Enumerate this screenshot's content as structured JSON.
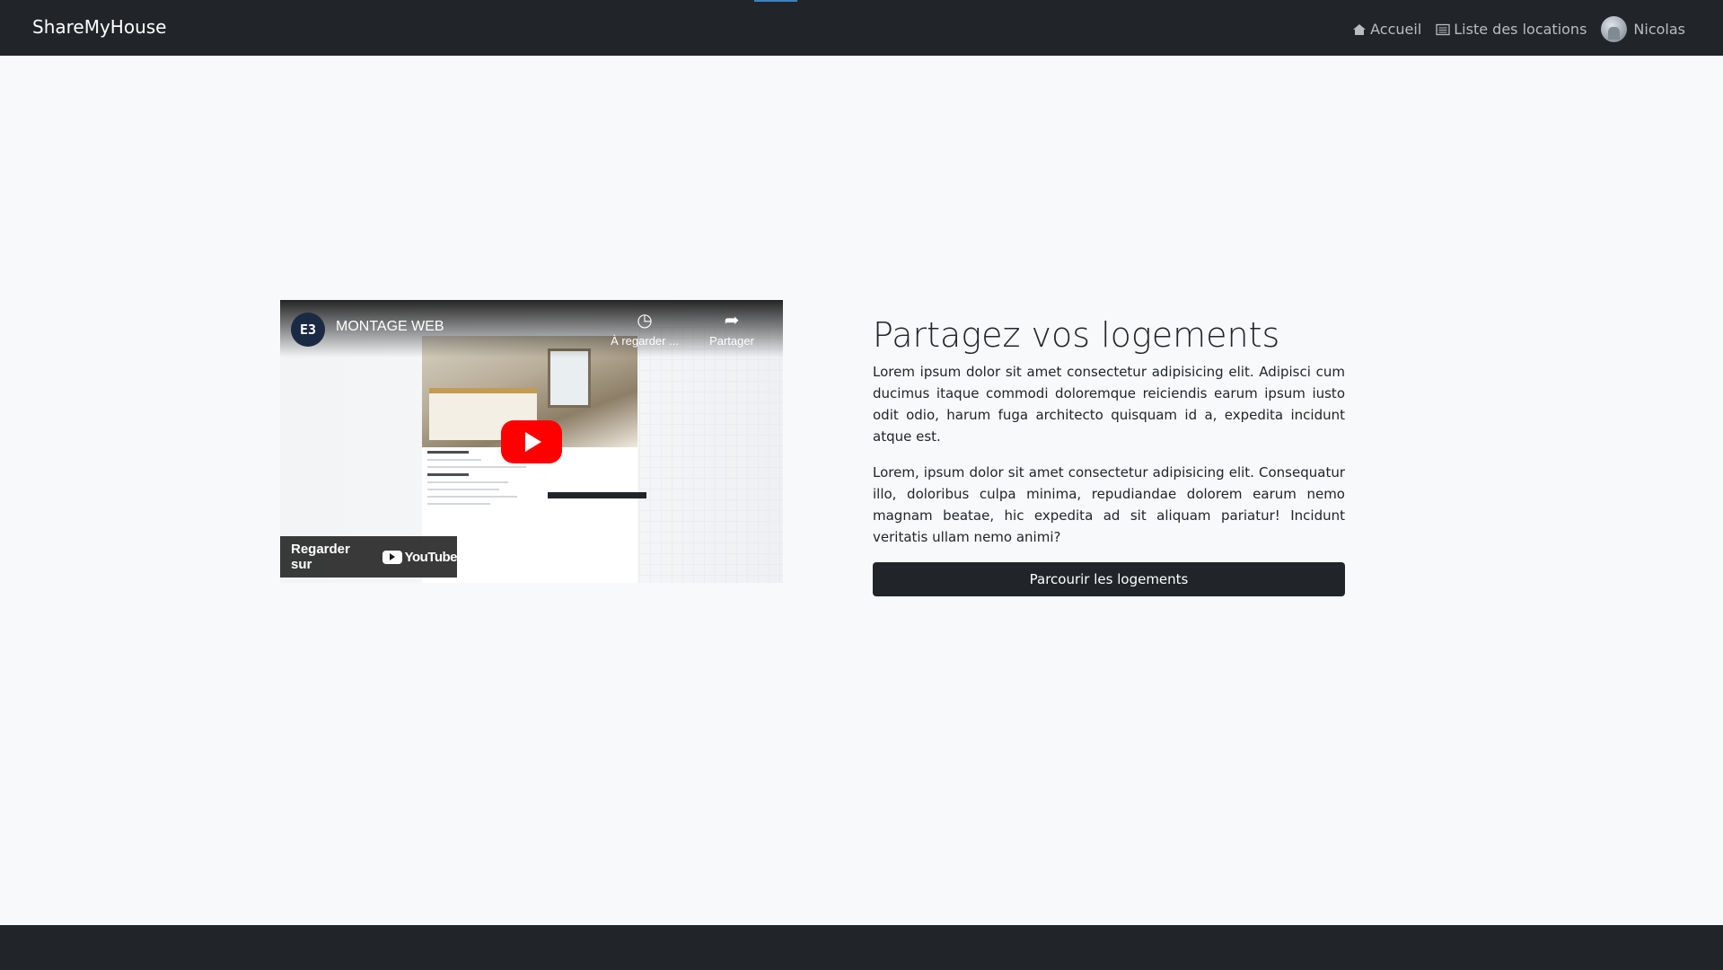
{
  "navbar": {
    "brand": "ShareMyHouse",
    "links": [
      {
        "label": "Accueil",
        "icon": "house-icon"
      },
      {
        "label": "Liste des locations",
        "icon": "list-icon"
      }
    ],
    "user": {
      "name": "Nicolas",
      "icon": "avatar"
    }
  },
  "video": {
    "channel_logo_text": "E3",
    "title": "MONTAGE WEB",
    "watch_later": "À regarder ...",
    "share": "Partager",
    "watch_on": "Regarder sur",
    "youtube": "YouTube"
  },
  "main": {
    "title": "Partagez vos logements",
    "paragraphs": [
      "Lorem ipsum dolor sit amet consectetur adipisicing elit. Adipisci cum ducimus itaque commodi doloremque reiciendis earum ipsum iusto odit odio, harum fuga architecto quisquam id a, expedita incidunt atque est.",
      "Lorem, ipsum dolor sit amet consectetur adipisicing elit. Consequatur illo, doloribus culpa minima, repudiandae dolorem earum nemo magnam beatae, hic expedita ad sit aliquam pariatur! Incidunt veritatis ullam nemo animi?"
    ],
    "cta_label": "Parcourir les logements"
  },
  "colors": {
    "navbar": "#212529",
    "background": "#f8f9fa",
    "button": "#212529",
    "youtube_red": "#ff0000"
  }
}
